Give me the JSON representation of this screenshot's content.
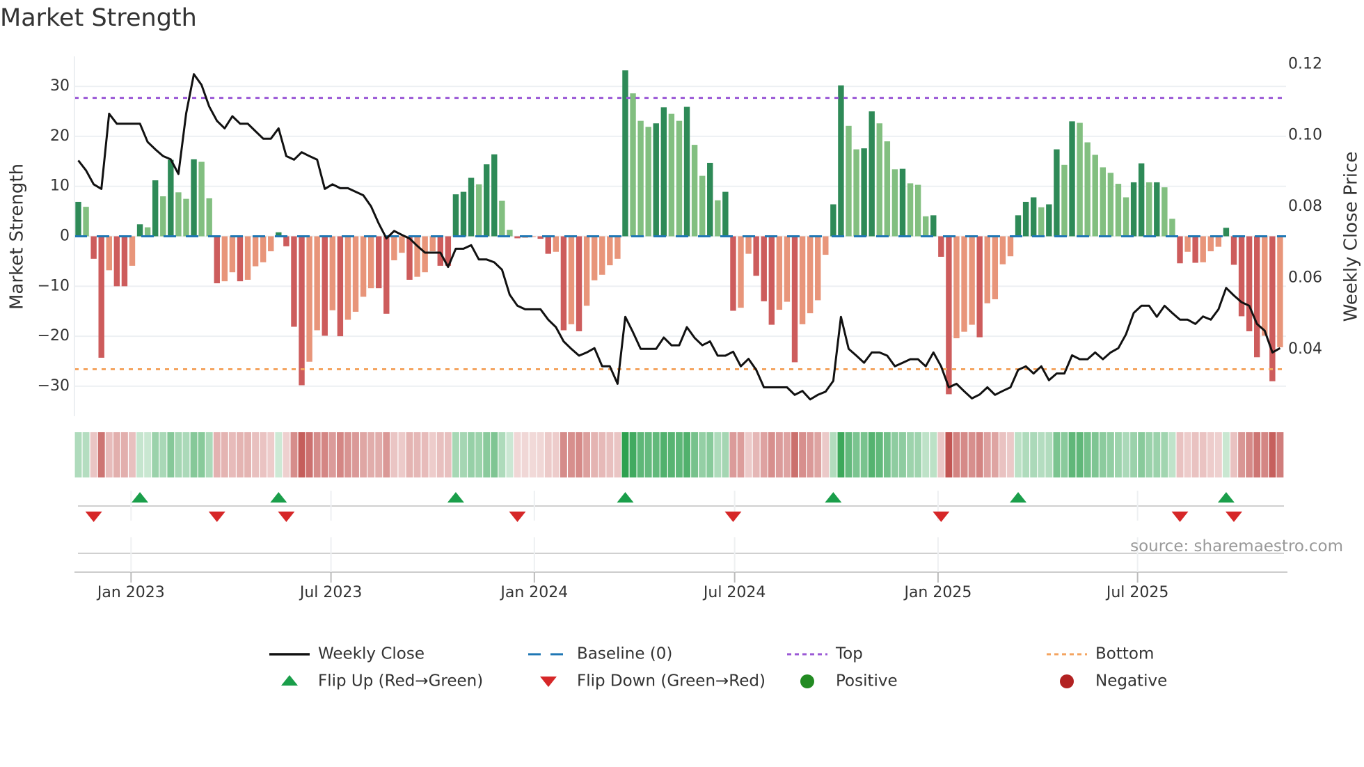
{
  "title": "Market Strength",
  "source": "source: sharemaestro.com",
  "colors": {
    "pos_strong": "#2e8a57",
    "pos_weak": "#82bf80",
    "neg_strong": "#cd5c5c",
    "neg_weak": "#e8957a",
    "baseline": "#1f77b4",
    "top": "#9b59d6",
    "bottom": "#f4a460",
    "flip_up": "#1a9e4a",
    "flip_down": "#d62728",
    "positive": "#228b22",
    "negative": "#b22222",
    "line": "#111111"
  },
  "legend": [
    {
      "label": "Weekly Close",
      "icon": "solid-line"
    },
    {
      "label": "Baseline (0)",
      "icon": "dashed-line"
    },
    {
      "label": "Top",
      "icon": "dotted-line-purple"
    },
    {
      "label": "Bottom",
      "icon": "dotted-line-orange"
    },
    {
      "label": "Flip Up (Red→Green)",
      "icon": "triangle-up"
    },
    {
      "label": "Flip Down (Green→Red)",
      "icon": "triangle-down"
    },
    {
      "label": "Positive",
      "icon": "circle-green"
    },
    {
      "label": "Negative",
      "icon": "circle-red"
    }
  ],
  "chart_data": {
    "type": "bar",
    "title": "Market Strength",
    "ylabel": "Market Strength",
    "ylabel_right": "Weekly Close Price",
    "ylim": [
      -36,
      36
    ],
    "ylim_right": [
      0.0212,
      0.1222
    ],
    "yticks": [
      -30,
      -20,
      -10,
      0,
      10,
      20,
      30
    ],
    "yticks_right": [
      "0.04",
      "0.06",
      "0.08",
      "0.10",
      "0.12"
    ],
    "top_level": 27.7,
    "bottom_level": -26.6,
    "baseline": 0,
    "x_unit": "week index",
    "xticks": [
      {
        "label": "Jan 2023",
        "week": 6.85
      },
      {
        "label": "Jul 2023",
        "week": 32.8
      },
      {
        "label": "Jan 2024",
        "week": 59.2
      },
      {
        "label": "Jul 2024",
        "week": 85.2
      },
      {
        "label": "Jan 2025",
        "week": 111.6
      },
      {
        "label": "Jul 2025",
        "week": 137.5
      }
    ],
    "strength": [
      6.9,
      5.9,
      -4.5,
      -24.3,
      -6.8,
      -10,
      -10,
      -5.9,
      2.4,
      1.8,
      11.2,
      8,
      15.3,
      8.8,
      7.5,
      15.4,
      14.9,
      7.6,
      -9.4,
      -9,
      -7.2,
      -9,
      -8.7,
      -6,
      -5.2,
      -3,
      0.8,
      -2,
      -18.1,
      -29.8,
      -25.1,
      -18.8,
      -19.9,
      -14.8,
      -20,
      -16.7,
      -15.1,
      -12.1,
      -10.4,
      -10.4,
      -15.5,
      -4.8,
      -3.3,
      -8.7,
      -8.1,
      -7.2,
      -3,
      -5.9,
      -5.9,
      8.4,
      8.9,
      11.7,
      10.4,
      14.4,
      16.4,
      7.1,
      1.3,
      -0.4,
      -0.3,
      -0.1,
      -0.5,
      -3.5,
      -3.1,
      -18.8,
      -17.6,
      -19,
      -13.9,
      -8.8,
      -7.7,
      -5.8,
      -4.5,
      33.2,
      28.6,
      23.1,
      21.9,
      22.6,
      25.8,
      24.5,
      23.1,
      25.9,
      18.3,
      12.1,
      14.7,
      7.2,
      8.9,
      -14.9,
      -14.3,
      -3.5,
      -7.9,
      -13,
      -17.7,
      -14.7,
      -13.1,
      -25.2,
      -17.6,
      -15.4,
      -12.8,
      -3.7,
      6.4,
      30.2,
      22.1,
      17.4,
      17.6,
      25,
      22.6,
      19,
      13.4,
      13.5,
      10.6,
      10.3,
      4,
      4.2,
      -4.1,
      -31.6,
      -20.4,
      -19.1,
      -17.7,
      -20.2,
      -13.4,
      -12.6,
      -5.6,
      -4,
      4.2,
      6.9,
      7.8,
      5.8,
      6.4,
      17.4,
      14.3,
      23,
      22.7,
      18.8,
      16.3,
      13.8,
      12.7,
      10.5,
      7.8,
      10.8,
      14.6,
      10.8,
      10.8,
      9.8,
      3.5,
      -5.4,
      -3.1,
      -5.3,
      -5.2,
      -3,
      -2.1,
      1.7,
      -5.7,
      -16,
      -19,
      -24.2,
      -19.9,
      -29,
      -22.2
    ],
    "close": [
      0.093,
      0.0902,
      0.0863,
      0.085,
      0.1061,
      0.1033,
      0.1033,
      0.1033,
      0.1033,
      0.0982,
      0.0961,
      0.0942,
      0.0933,
      0.0892,
      0.1062,
      0.1172,
      0.1142,
      0.1081,
      0.1041,
      0.102,
      0.1054,
      0.1033,
      0.1033,
      0.1012,
      0.0991,
      0.0991,
      0.102,
      0.0942,
      0.0932,
      0.0953,
      0.0942,
      0.0932,
      0.085,
      0.0863,
      0.0852,
      0.0852,
      0.0842,
      0.0832,
      0.0801,
      0.0753,
      0.0711,
      0.0732,
      0.0721,
      0.0711,
      0.069,
      0.0671,
      0.0671,
      0.0671,
      0.0631,
      0.0682,
      0.0682,
      0.0692,
      0.0652,
      0.0652,
      0.0644,
      0.0623,
      0.0553,
      0.0522,
      0.0512,
      0.0512,
      0.0512,
      0.0483,
      0.0462,
      0.0422,
      0.0401,
      0.0382,
      0.0391,
      0.0403,
      0.0352,
      0.0352,
      0.0303,
      0.0491,
      0.0448,
      0.0401,
      0.0401,
      0.0401,
      0.0433,
      0.0411,
      0.0411,
      0.0462,
      0.0432,
      0.0411,
      0.0422,
      0.0382,
      0.0382,
      0.0393,
      0.0352,
      0.0373,
      0.0342,
      0.0293,
      0.0293,
      0.0293,
      0.0293,
      0.0272,
      0.0283,
      0.0259,
      0.0272,
      0.0281,
      0.0311,
      0.0491,
      0.0401,
      0.0382,
      0.0362,
      0.0391,
      0.0391,
      0.0382,
      0.0352,
      0.0362,
      0.0372,
      0.0372,
      0.0352,
      0.0391,
      0.0352,
      0.0293,
      0.0303,
      0.0282,
      0.0262,
      0.0273,
      0.0293,
      0.0272,
      0.0283,
      0.0293,
      0.0342,
      0.0352,
      0.0332,
      0.0352,
      0.0313,
      0.0332,
      0.0332,
      0.0383,
      0.0372,
      0.0372,
      0.0391,
      0.0372,
      0.0391,
      0.0403,
      0.0442,
      0.0502,
      0.0522,
      0.0522,
      0.0491,
      0.0522,
      0.0502,
      0.0483,
      0.0483,
      0.0471,
      0.0492,
      0.0483,
      0.0512,
      0.0572,
      0.0551,
      0.0532,
      0.0522,
      0.0471,
      0.0452,
      0.0391,
      0.0403
    ]
  }
}
